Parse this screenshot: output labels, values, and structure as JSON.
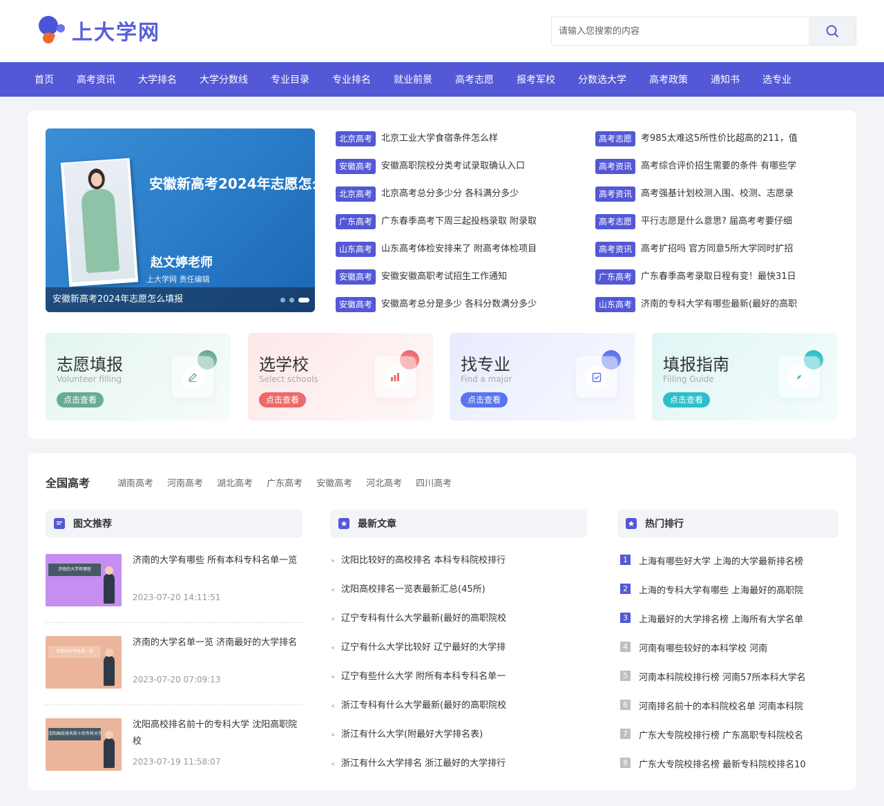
{
  "header": {
    "logo_text": "上大学网",
    "search_placeholder": "请输入您搜索的内容"
  },
  "nav": [
    "首页",
    "高考资讯",
    "大学排名",
    "大学分数线",
    "专业目录",
    "专业排名",
    "就业前景",
    "高考志愿",
    "报考军校",
    "分数选大学",
    "高考政策",
    "通知书",
    "选专业"
  ],
  "banner": {
    "title": "安徽新高考2024年志愿怎么填报",
    "teacher": "赵文婷老师",
    "sub": "上大学网  责任编辑",
    "caption": "安徽新高考2024年志愿怎么填报"
  },
  "news_left": [
    {
      "tag": "北京高考",
      "title": "北京工业大学食宿条件怎么样"
    },
    {
      "tag": "安徽高考",
      "title": "安徽高职院校分类考试录取确认入口"
    },
    {
      "tag": "北京高考",
      "title": "北京高考总分多少分 各科满分多少"
    },
    {
      "tag": "广东高考",
      "title": "广东春季高考下周三起投档录取 附录取"
    },
    {
      "tag": "山东高考",
      "title": "山东高考体检安排来了 附高考体检项目"
    },
    {
      "tag": "安徽高考",
      "title": "安徽安徽高职考试招生工作通知"
    },
    {
      "tag": "安徽高考",
      "title": "安徽高考总分是多少 各科分数满分多少"
    }
  ],
  "news_right": [
    {
      "tag": "高考志愿",
      "title": "考985太难这5所性价比超高的211，值"
    },
    {
      "tag": "高考资讯",
      "title": "高考综合评价招生需要的条件 有哪些学"
    },
    {
      "tag": "高考资讯",
      "title": "高考强基计划校测入围、校测、志愿录"
    },
    {
      "tag": "高考志愿",
      "title": "平行志愿是什么意思? 届高考考要仔细"
    },
    {
      "tag": "高考资讯",
      "title": "高考扩招吗 官方同意5所大学同时扩招"
    },
    {
      "tag": "广东高考",
      "title": "广东春季高考录取日程有变！最快31日"
    },
    {
      "tag": "山东高考",
      "title": "济南的专科大学有哪些最新(最好的高职"
    }
  ],
  "cards": [
    {
      "title": "志愿填报",
      "sub": "Volunteer filling",
      "btn": "点击查看",
      "color": "#6aab96",
      "bg": "#e3f5f0",
      "icon": "pencil-icon"
    },
    {
      "title": "选学校",
      "sub": "Select schools",
      "btn": "点击查看",
      "color": "#ec6a6a",
      "bg": "#fde7e8",
      "icon": "bar-chart-icon"
    },
    {
      "title": "找专业",
      "sub": "Find a major",
      "btn": "点击查看",
      "color": "#5a73ee",
      "bg": "#e7ebfd",
      "icon": "clipboard-check-icon"
    },
    {
      "title": "填报指南",
      "sub": "Filling Guide",
      "btn": "点击查看",
      "color": "#2cbfc9",
      "bg": "#dff5f5",
      "icon": "compass-icon"
    }
  ],
  "province_tabs": {
    "main": "全国高考",
    "tabs": [
      "湖南高考",
      "河南高考",
      "湖北高考",
      "广东高考",
      "安徽高考",
      "河北高考",
      "四川高考"
    ]
  },
  "sections": {
    "recommend": "图文推荐",
    "latest": "最新文章",
    "hot": "热门排行"
  },
  "articles": [
    {
      "title": "济南的大学有哪些 所有本科专科名单一览",
      "date": "2023-07-20 14:11:51",
      "thumb_text": "济南的大学有哪些",
      "thumb_bg": "#c58ef0"
    },
    {
      "title": "济南的大学名单一览 济南最好的大学排名",
      "date": "2023-07-20 07:09:13",
      "thumb_text": "济南的大学名单一览",
      "thumb_bg": "#eab59a"
    },
    {
      "title": "沈阳高校排名前十的专科大学 沈阳高职院校",
      "date": "2023-07-19 11:58:07",
      "thumb_text": "沈阳高校排名前十的专科大学",
      "thumb_bg": "#eab59a"
    }
  ],
  "latest": [
    "沈阳比较好的高校排名 本科专科院校排行",
    "沈阳高校排名一览表最新汇总(45所)",
    "辽宁专科有什么大学最新(最好的高职院校",
    "辽宁有什么大学比较好 辽宁最好的大学排",
    "辽宁有些什么大学 附所有本科专科名单一",
    "浙江专科有什么大学最新(最好的高职院校",
    "浙江有什么大学(附最好大学排名表)",
    "浙江有什么大学排名 浙江最好的大学排行"
  ],
  "hot": [
    {
      "rank": "1",
      "title": "上海有哪些好大学 上海的大学最新排名榜"
    },
    {
      "rank": "2",
      "title": "上海的专科大学有哪些 上海最好的高职院"
    },
    {
      "rank": "3",
      "title": "上海最好的大学排名榜 上海所有大学名单"
    },
    {
      "rank": "4",
      "title": "河南有哪些较好的本科学校 河南"
    },
    {
      "rank": "5",
      "title": "河南本科院校排行榜 河南57所本科大学名"
    },
    {
      "rank": "6",
      "title": "河南排名前十的本科院校名单 河南本科院"
    },
    {
      "rank": "7",
      "title": "广东大专院校排行榜 广东高职专科院校名"
    },
    {
      "rank": "8",
      "title": "广东大专院校排名榜 最新专科院校排名10"
    }
  ]
}
